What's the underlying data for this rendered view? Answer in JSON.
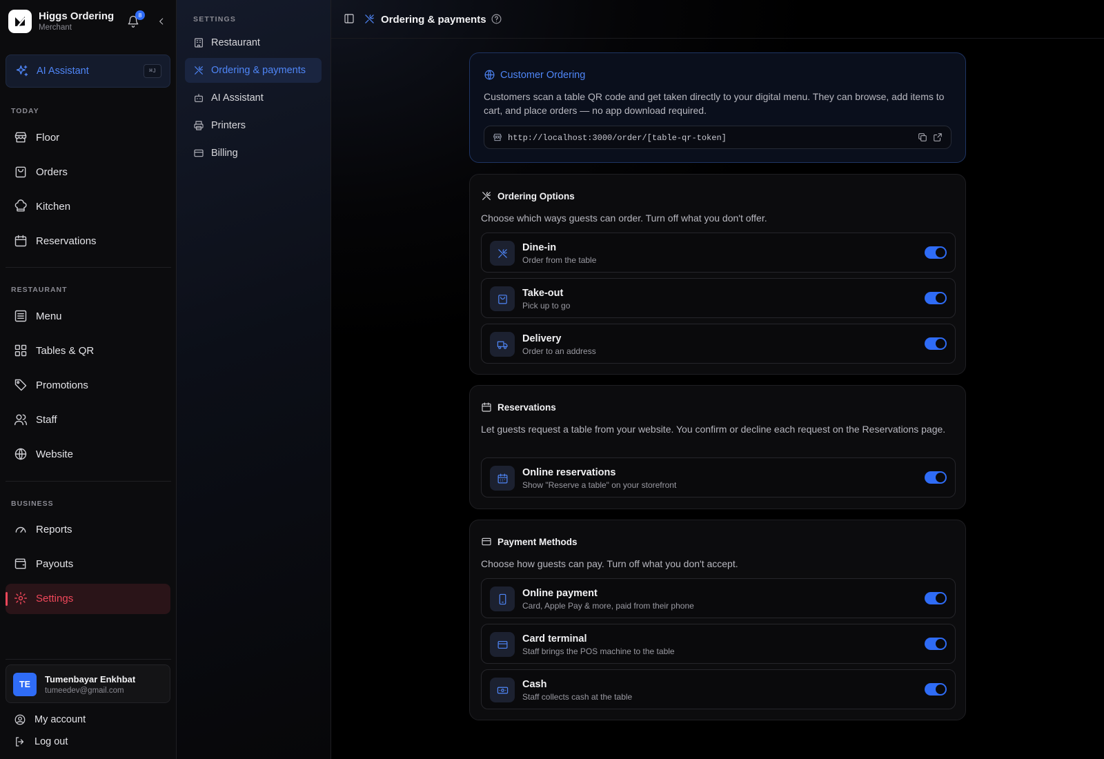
{
  "brand": {
    "name": "Higgs Ordering",
    "subtitle": "Merchant",
    "notifications": "8"
  },
  "ai_button": {
    "label": "AI Assistant",
    "shortcut": "⌘J"
  },
  "sidebar": {
    "sections": [
      {
        "label": "TODAY",
        "items": [
          {
            "label": "Floor",
            "icon": "store-icon"
          },
          {
            "label": "Orders",
            "icon": "bag-icon"
          },
          {
            "label": "Kitchen",
            "icon": "chef-hat-icon"
          },
          {
            "label": "Reservations",
            "icon": "calendar-icon"
          }
        ]
      },
      {
        "label": "RESTAURANT",
        "items": [
          {
            "label": "Menu",
            "icon": "list-icon"
          },
          {
            "label": "Tables & QR",
            "icon": "grid-icon"
          },
          {
            "label": "Promotions",
            "icon": "tag-icon"
          },
          {
            "label": "Staff",
            "icon": "users-icon"
          },
          {
            "label": "Website",
            "icon": "globe-icon"
          }
        ]
      },
      {
        "label": "BUSINESS",
        "items": [
          {
            "label": "Reports",
            "icon": "gauge-icon"
          },
          {
            "label": "Payouts",
            "icon": "wallet-icon"
          },
          {
            "label": "Settings",
            "icon": "gear-icon",
            "active": true
          }
        ]
      }
    ]
  },
  "user": {
    "initials": "TE",
    "name": "Tumenbayar Enkhbat",
    "email": "tumeedev@gmail.com"
  },
  "footer": {
    "account": "My account",
    "logout": "Log out"
  },
  "settings_nav": {
    "title": "SETTINGS",
    "items": [
      {
        "label": "Restaurant",
        "icon": "building-icon"
      },
      {
        "label": "Ordering & payments",
        "icon": "utensils-icon",
        "active": true
      },
      {
        "label": "AI Assistant",
        "icon": "bot-icon"
      },
      {
        "label": "Printers",
        "icon": "printer-icon"
      },
      {
        "label": "Billing",
        "icon": "card-icon"
      }
    ]
  },
  "header": {
    "title": "Ordering & payments"
  },
  "customer_ordering": {
    "title": "Customer Ordering",
    "description": "Customers scan a table QR code and get taken directly to your digital menu. They can browse, add items to cart, and place orders — no app download required.",
    "url": "http://localhost:3000/order/[table-qr-token]"
  },
  "ordering_options": {
    "title": "Ordering Options",
    "description": "Choose which ways guests can order. Turn off what you don't offer.",
    "items": [
      {
        "name": "Dine-in",
        "sub": "Order from the table",
        "enabled": true
      },
      {
        "name": "Take-out",
        "sub": "Pick up to go",
        "enabled": true
      },
      {
        "name": "Delivery",
        "sub": "Order to an address",
        "enabled": true
      }
    ]
  },
  "reservations": {
    "title": "Reservations",
    "description": "Let guests request a table from your website. You confirm or decline each request on the Reservations page.",
    "items": [
      {
        "name": "Online reservations",
        "sub": "Show \"Reserve a table\" on your storefront",
        "enabled": true
      }
    ]
  },
  "payment_methods": {
    "title": "Payment Methods",
    "description": "Choose how guests can pay. Turn off what you don't accept.",
    "items": [
      {
        "name": "Online payment",
        "sub": "Card, Apple Pay & more, paid from their phone",
        "enabled": true
      },
      {
        "name": "Card terminal",
        "sub": "Staff brings the POS machine to the table",
        "enabled": true
      },
      {
        "name": "Cash",
        "sub": "Staff collects cash at the table",
        "enabled": true
      }
    ]
  },
  "colors": {
    "accent": "#2f6cf6",
    "active_nav": "#f0475a",
    "background": "#000000"
  }
}
